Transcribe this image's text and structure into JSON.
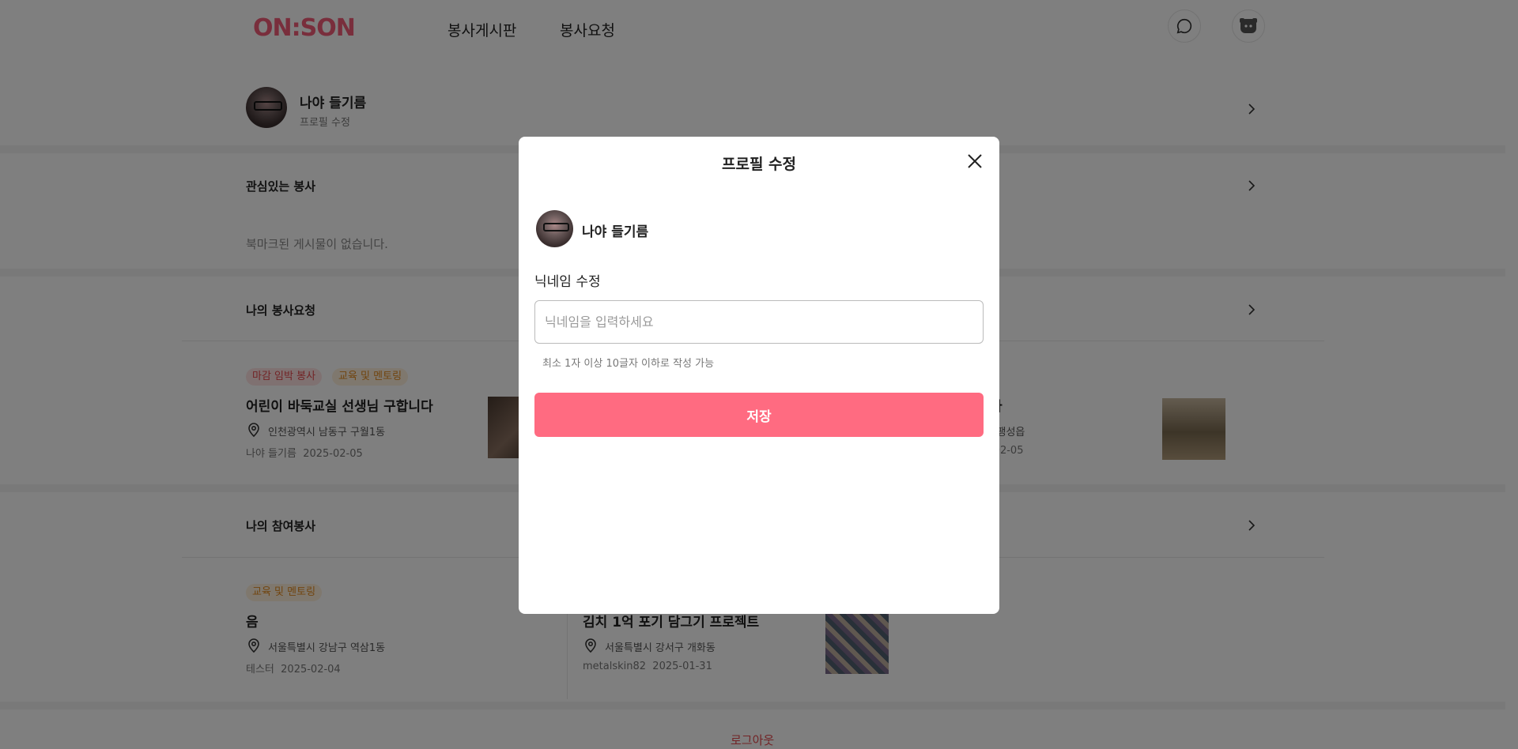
{
  "header": {
    "logo": "ON:SON",
    "nav": [
      "봉사게시판",
      "봉사요청"
    ],
    "chat_icon": "chat-bubble-icon",
    "user_icon": "user-avatar-icon"
  },
  "profile": {
    "name": "나야 들기름",
    "edit_link": "프로필 수정"
  },
  "sections": {
    "bookmark_title": "관심있는 봉사",
    "bookmark_empty": "북마크된 게시물이 없습니다.",
    "my_requests_title": "나의 봉사요청",
    "my_participation_title": "나의 참여봉사"
  },
  "request_cards": [
    {
      "tags": [
        "마감 임박 봉사",
        "교육 및 멘토링"
      ],
      "title": "어린이 바둑교실 선생님 구합니다",
      "location": "인천광역시 남동구 구월1동",
      "author": "나야 들기름",
      "date": "2025-02-05"
    },
    {
      "title_partial": "사",
      "location_partial": "| 팽성읍",
      "date_partial": "-02-05"
    }
  ],
  "participation_cards": [
    {
      "tags": [
        "교육 및 멘토링"
      ],
      "title": "음",
      "location": "서울특별시 강남구 역삼1동",
      "author": "테스터",
      "date": "2025-02-04"
    },
    {
      "title": "김치 1억 포기 담그기 프로젝트",
      "location": "서울특별시 강서구 개화동",
      "author": "metalskin82",
      "date": "2025-01-31"
    }
  ],
  "logout": "로그아웃",
  "modal": {
    "title": "프로필 수정",
    "name": "나야 들기름",
    "field_label": "닉네임 수정",
    "input_placeholder": "닉네임을 입력하세요",
    "input_value": "",
    "hint": "최소 1자 이상 10글자 이하로 작성 가능",
    "save_label": "저장"
  },
  "colors": {
    "brand": "#f25d78",
    "save_button": "#ff6b81",
    "overlay": "rgba(0,0,0,0.5)"
  }
}
